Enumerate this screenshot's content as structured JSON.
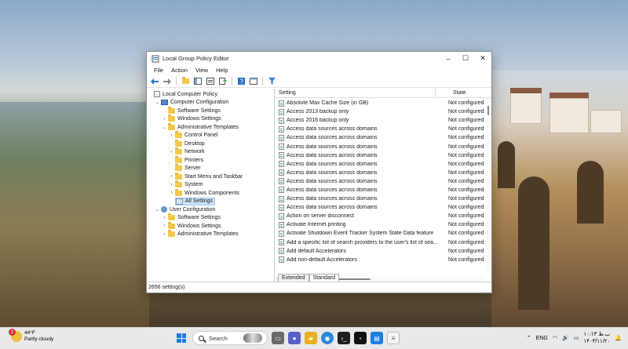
{
  "window": {
    "title": "Local Group Policy Editor",
    "controls": {
      "minimize": "–",
      "maximize": "☐",
      "close": "✕"
    }
  },
  "menu": [
    "File",
    "Action",
    "View",
    "Help"
  ],
  "tree": {
    "root": "Local Computer Policy",
    "computer_config": "Computer Configuration",
    "software_settings": "Software Settings",
    "windows_settings": "Windows Settings",
    "admin_templates": "Administrative Templates",
    "control_panel": "Control Panel",
    "desktop": "Desktop",
    "network": "Network",
    "printers": "Printers",
    "server": "Server",
    "start_menu": "Start Menu and Taskbar",
    "system": "System",
    "windows_components": "Windows Components",
    "all_settings": "All Settings",
    "user_config": "User Configuration",
    "user_software_settings": "Software Settings",
    "user_windows_settings": "Windows Settings",
    "user_admin_templates": "Administrative Templates"
  },
  "list": {
    "col_setting": "Setting",
    "col_state": "State",
    "rows": [
      {
        "name": "Absolute Max Cache Size (in GB)",
        "state": "Not configured"
      },
      {
        "name": "Access 2013 backup only",
        "state": "Not configured"
      },
      {
        "name": "Access 2016 backup only",
        "state": "Not configured"
      },
      {
        "name": "Access data sources across domains",
        "state": "Not configured"
      },
      {
        "name": "Access data sources across domains",
        "state": "Not configured"
      },
      {
        "name": "Access data sources across domains",
        "state": "Not configured"
      },
      {
        "name": "Access data sources across domains",
        "state": "Not configured"
      },
      {
        "name": "Access data sources across domains",
        "state": "Not configured"
      },
      {
        "name": "Access data sources across domains",
        "state": "Not configured"
      },
      {
        "name": "Access data sources across domains",
        "state": "Not configured"
      },
      {
        "name": "Access data sources across domains",
        "state": "Not configured"
      },
      {
        "name": "Access data sources across domains",
        "state": "Not configured"
      },
      {
        "name": "Access data sources across domains",
        "state": "Not configured"
      },
      {
        "name": "Action on server disconnect",
        "state": "Not configured"
      },
      {
        "name": "Activate Internet printing",
        "state": "Not configured"
      },
      {
        "name": "Activate Shutdown Event Tracker System State Data feature",
        "state": "Not configured"
      },
      {
        "name": "Add a specific list of search providers to the user's list of sea...",
        "state": "Not configured"
      },
      {
        "name": "Add default Accelerators",
        "state": "Not configured"
      },
      {
        "name": "Add non-default Accelerators",
        "state": "Not configured"
      }
    ]
  },
  "tabs": {
    "extended": "Extended",
    "standard": "Standard"
  },
  "status": "2656 setting(s)",
  "taskbar": {
    "weather_temp": "44°F",
    "weather_desc": "Partly cloudy",
    "weather_badge": "2",
    "search_placeholder": "Search",
    "lang": "ENG",
    "time": "۱۰:۱۳ ب.ظ",
    "date": "۱۴۰۳/۱۱/۲۰"
  }
}
